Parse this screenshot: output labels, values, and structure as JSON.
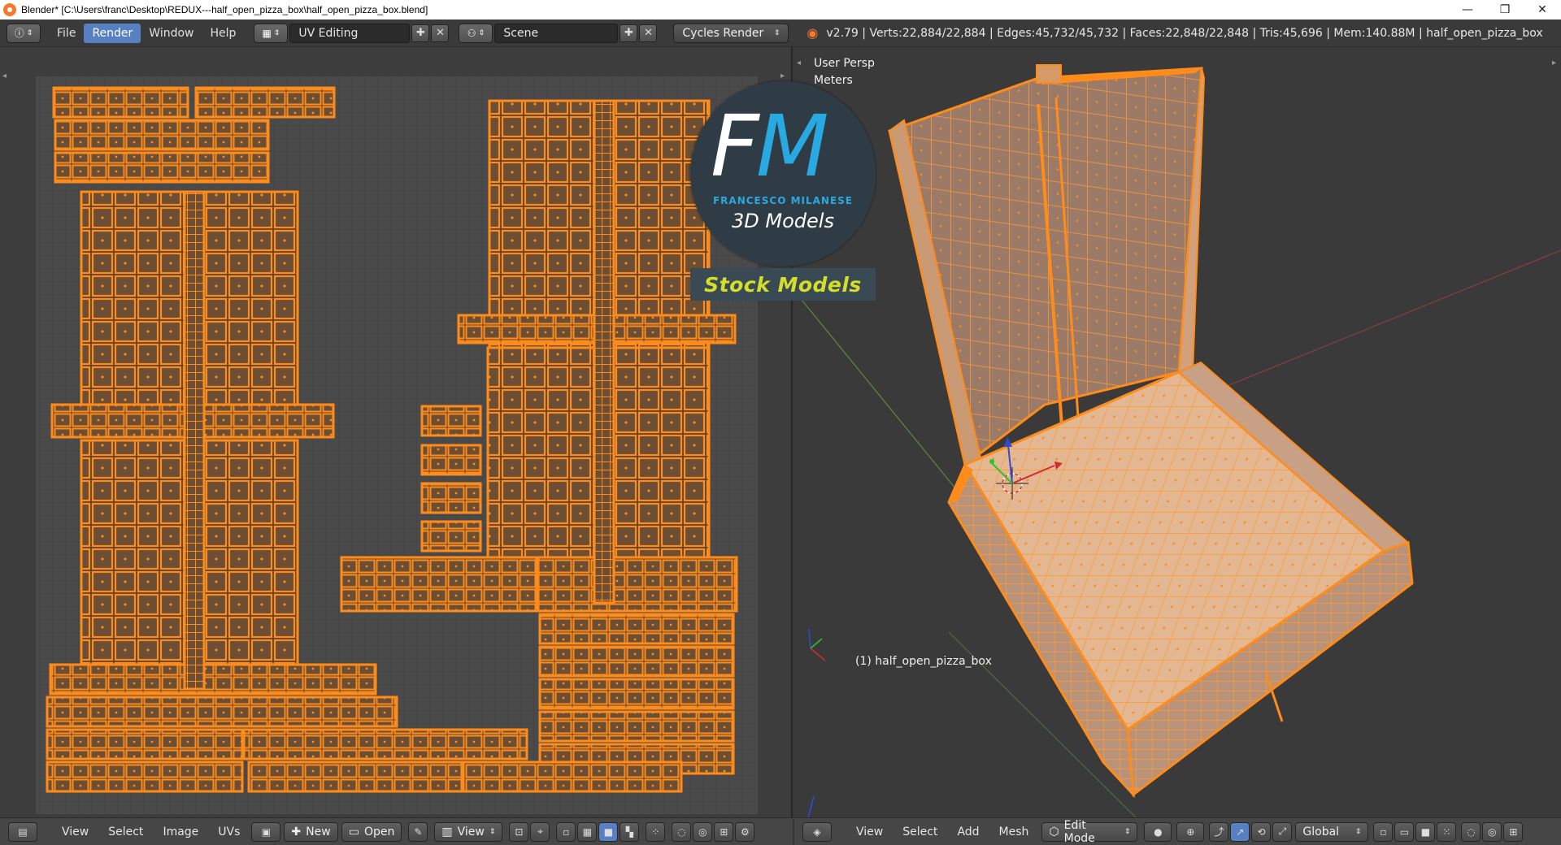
{
  "window": {
    "title": "Blender* [C:\\Users\\franc\\Desktop\\REDUX---half_open_pizza_box\\half_open_pizza_box.blend]",
    "minimize": "—",
    "maximize": "❐",
    "close": "✕"
  },
  "info_header": {
    "menus": [
      "File",
      "Render",
      "Window",
      "Help"
    ],
    "active_menu": "Render",
    "screen_layout": "UV Editing",
    "scene": "Scene",
    "render_engine": "Cycles Render",
    "stats": "v2.79 | Verts:22,884/22,884 | Edges:45,732/45,732 | Faces:22,848/22,848 | Tris:45,696 | Mem:140.88M | half_open_pizza_box"
  },
  "uv_editor": {
    "menus": [
      "View",
      "Select",
      "Image",
      "UVs"
    ],
    "new_label": "New",
    "open_label": "Open",
    "view_label": "View"
  },
  "viewport": {
    "view_name": "User Persp",
    "units": "Meters",
    "object_label": "(1) half_open_pizza_box",
    "menus": [
      "View",
      "Select",
      "Add",
      "Mesh"
    ],
    "mode": "Edit Mode",
    "orientation": "Global"
  },
  "overlay": {
    "logo_f": "F",
    "logo_m": "M",
    "brand": "FRANCESCO MILANESE",
    "tagline": "3D Models",
    "badge": "Stock Models"
  },
  "colors": {
    "mesh_orange": "#ff8c1a",
    "uv_grid_bg": "#4a4a4a",
    "accent_blue": "#5680c2",
    "logo_blue": "#29a9e1",
    "badge_yellow": "#d4de2a"
  }
}
